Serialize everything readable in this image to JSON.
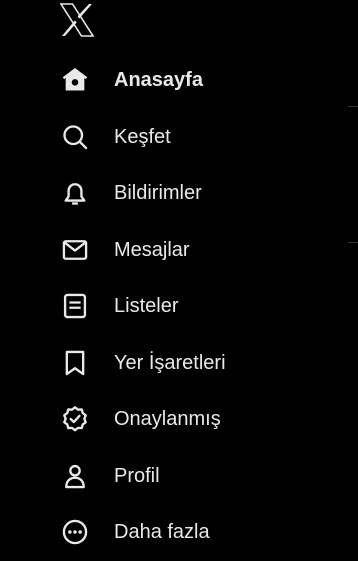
{
  "brand": {
    "logo_icon": "x-logo-icon"
  },
  "colors": {
    "background": "#000000",
    "text": "#e7e9ea",
    "divider": "#2f3336"
  },
  "nav": {
    "items": [
      {
        "label": "Anasayfa",
        "icon": "home-icon",
        "active": true
      },
      {
        "label": "Keşfet",
        "icon": "search-icon",
        "active": false
      },
      {
        "label": "Bildirimler",
        "icon": "bell-icon",
        "active": false
      },
      {
        "label": "Mesajlar",
        "icon": "envelope-icon",
        "active": false
      },
      {
        "label": "Listeler",
        "icon": "list-icon",
        "active": false
      },
      {
        "label": "Yer İşaretleri",
        "icon": "bookmark-icon",
        "active": false
      },
      {
        "label": "Onaylanmış",
        "icon": "verified-badge-icon",
        "active": false
      },
      {
        "label": "Profil",
        "icon": "person-icon",
        "active": false
      },
      {
        "label": "Daha fazla",
        "icon": "more-circle-icon",
        "active": false
      }
    ]
  }
}
